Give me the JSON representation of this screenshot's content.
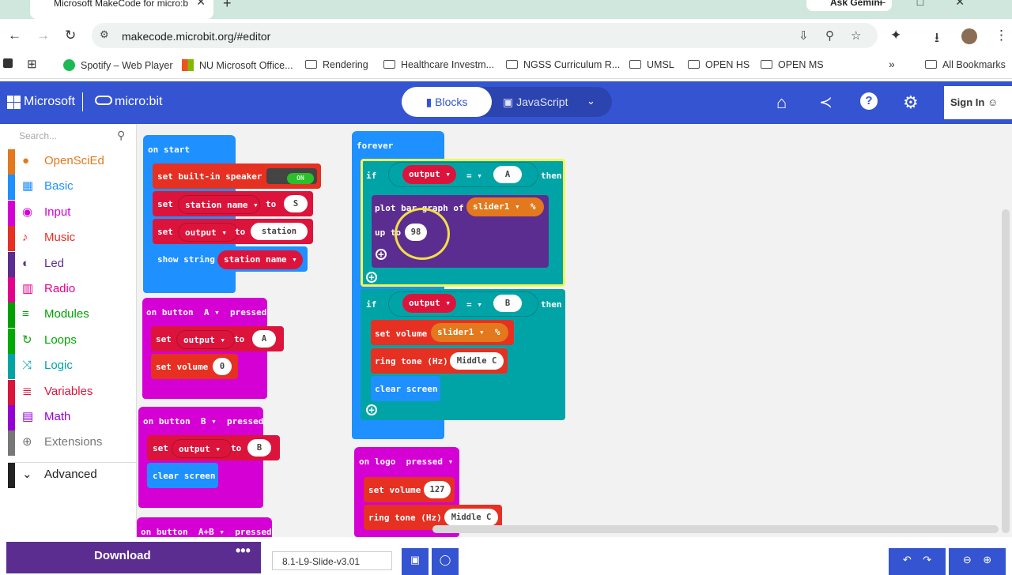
{
  "browser": {
    "tab_title": "Microsoft MakeCode for micro:b",
    "ask_gemini": "Ask Gemini",
    "url": "makecode.microbit.org/#editor",
    "bookmarks": [
      "Spotify – Web Player",
      "NU Microsoft Office...",
      "Rendering",
      "Healthcare Investm...",
      "NGSS Curriculum R...",
      "UMSL",
      "OPEN HS",
      "OPEN MS"
    ],
    "all_bookmarks": "All Bookmarks"
  },
  "header": {
    "microsoft": "Microsoft",
    "product": "micro:bit",
    "blocks_tab": "Blocks",
    "javascript_tab": "JavaScript",
    "sign_in": "Sign In"
  },
  "toolbox": {
    "search_placeholder": "Search...",
    "categories": [
      {
        "label": "OpenSciEd",
        "color": "#e3781c"
      },
      {
        "label": "Basic",
        "color": "#1e90ff"
      },
      {
        "label": "Input",
        "color": "#d400d4"
      },
      {
        "label": "Music",
        "color": "#e63022"
      },
      {
        "label": "Led",
        "color": "#5c2d91"
      },
      {
        "label": "Radio",
        "color": "#e3008c"
      },
      {
        "label": "Modules",
        "color": "#00a000"
      },
      {
        "label": "Loops",
        "color": "#00aa00"
      },
      {
        "label": "Logic",
        "color": "#00a4a6"
      },
      {
        "label": "Variables",
        "color": "#dc143c"
      },
      {
        "label": "Math",
        "color": "#9400d3"
      },
      {
        "label": "Extensions",
        "color": "#777777"
      },
      {
        "label": "Advanced",
        "color": "#222222"
      }
    ]
  },
  "blocks": {
    "on_start": {
      "label": "on start",
      "speaker": "set built-in speaker",
      "speaker_toggle": "ON",
      "set1": "set",
      "var1": "station name",
      "to1": "to",
      "val1": "S",
      "set2": "set",
      "var2": "output",
      "to2": "to",
      "val2": "station",
      "show_string": "show string",
      "show_var": "station name"
    },
    "button_a": {
      "label": "on button",
      "btn": "A",
      "pressed": "pressed",
      "set": "set",
      "var": "output",
      "to": "to",
      "val": "A",
      "set_volume": "set volume",
      "vol": "0"
    },
    "button_b": {
      "label": "on button",
      "btn": "B",
      "pressed": "pressed",
      "set": "set",
      "var": "output",
      "to": "to",
      "val": "B",
      "clear": "clear screen"
    },
    "button_ab": {
      "label": "on button",
      "btn": "A+B",
      "pressed": "pressed"
    },
    "forever": {
      "label": "forever",
      "if1": "if",
      "cond1_var": "output",
      "op1": "=",
      "cond1_val": "A",
      "then1": "then",
      "plot": "plot bar graph of",
      "slider": "slider1",
      "pct": "%",
      "up_to": "up to",
      "up_val": "98",
      "if2": "if",
      "cond2_var": "output",
      "op2": "=",
      "cond2_val": "B",
      "then2": "then",
      "set_volume": "set volume",
      "slider2": "slider1",
      "pct2": "%",
      "ring_tone": "ring tone (Hz)",
      "note": "Middle C",
      "clear": "clear screen"
    },
    "on_logo": {
      "label": "on logo",
      "pressed": "pressed",
      "set_volume": "set volume",
      "vol": "127",
      "ring_tone": "ring tone (Hz)",
      "note": "Middle C"
    }
  },
  "bottom": {
    "download": "Download",
    "project_name": "8.1-L9-Slide-v3.01"
  }
}
